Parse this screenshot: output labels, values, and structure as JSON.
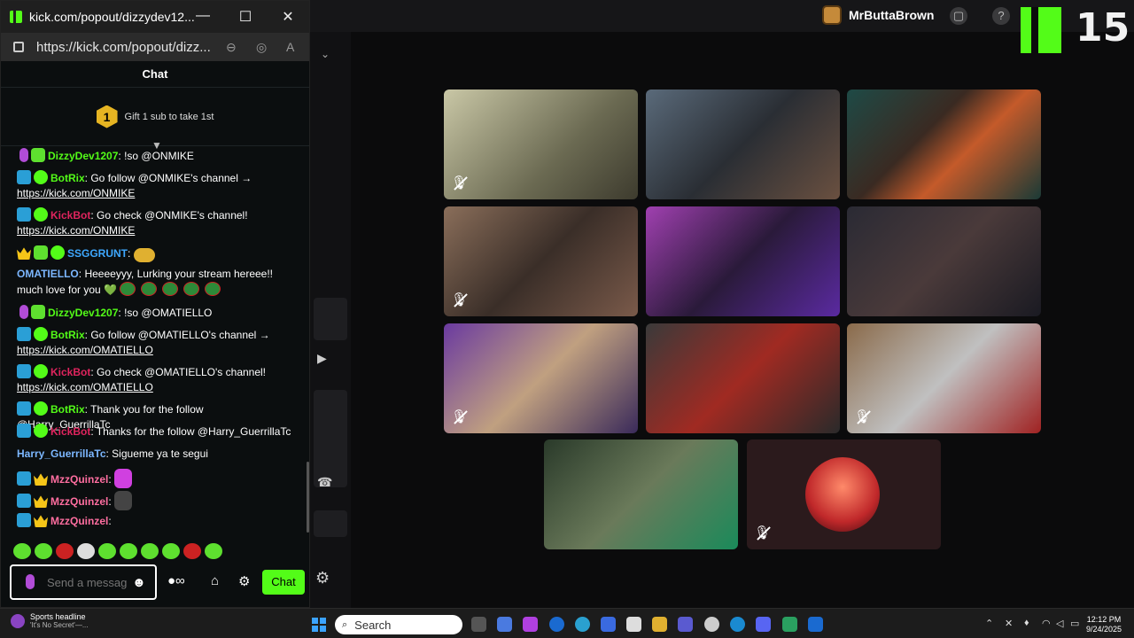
{
  "window": {
    "title": "kick.com/popout/dizzydev12...",
    "url": "https://kick.com/popout/dizz..."
  },
  "call": {
    "host_name": "MrButtaBrown",
    "viewer_count": "15",
    "brand_color": "#53fc18"
  },
  "chat": {
    "header": "Chat",
    "pinned_rank": "1",
    "pinned_text": "Gift 1 sub to take 1st",
    "messages": [
      {
        "user": "DizzyDev1207",
        "color": "#53fc18",
        "text": " !so @ONMIKE"
      },
      {
        "user": "BotRix",
        "color": "#53fc18",
        "text": " Go follow @ONMIKE's channel →",
        "link": "https://kick.com/ONMIKE"
      },
      {
        "user": "KickBot",
        "color": "#e0245e",
        "text": " Go check @ONMIKE's channel!",
        "link": "https://kick.com/ONMIKE"
      },
      {
        "user": "SSGGRUNT",
        "color": "#3ea8ff",
        "text": ""
      },
      {
        "user": "OMATIELLO",
        "color": "#7cb7ff",
        "text": " Heeeeyyy, Lurking your stream hereee!! much love for you 💚"
      },
      {
        "user": "DizzyDev1207",
        "color": "#53fc18",
        "text": " !so @OMATIELLO"
      },
      {
        "user": "BotRix",
        "color": "#53fc18",
        "text": " Go follow @OMATIELLO's channel →",
        "link": "https://kick.com/OMATIELLO"
      },
      {
        "user": "KickBot",
        "color": "#e0245e",
        "text": " Go check @OMATIELLO's channel!",
        "link": "https://kick.com/OMATIELLO"
      },
      {
        "user": "BotRix",
        "color": "#53fc18",
        "text": " Thank you for the follow @Harry_GuerrillaTc"
      },
      {
        "user": "KickBot",
        "color": "#e0245e",
        "text": " Thanks for the follow @Harry_GuerrillaTc"
      },
      {
        "user": "Harry_GuerrillaTc",
        "color": "#7cb7ff",
        "text": " Sigueme ya te segui"
      },
      {
        "user": "MzzQuinzel",
        "color": "#ff6ea0",
        "text": ""
      },
      {
        "user": "MzzQuinzel",
        "color": "#ff6ea0",
        "text": ""
      },
      {
        "user": "MzzQuinzel",
        "color": "#ff6ea0",
        "text": ""
      }
    ],
    "input_placeholder": "Send a message",
    "send_label": "Chat"
  },
  "taskbar": {
    "news_title": "Sports headline",
    "news_sub": "'It's No Secret'—...",
    "search_label": "Search",
    "time": "12:12 PM",
    "date": "9/24/2025"
  }
}
